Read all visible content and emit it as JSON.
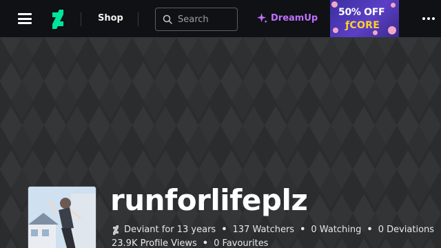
{
  "topbar": {
    "menu_icon": "hamburger-menu-icon",
    "logo_icon": "deviantart-logo-icon",
    "shop_label": "Shop",
    "search": {
      "placeholder": "Search",
      "value": "",
      "icon": "search-icon"
    },
    "dreamup": {
      "label": "DreamUp",
      "icon": "sparkle-icon",
      "color": "#c26fff"
    },
    "promo": {
      "line1": "50% OFF",
      "line2": "ƒCORE"
    },
    "more_icon": "more-dots-icon",
    "background": "#0f1114"
  },
  "profile": {
    "username": "runforlifeplz",
    "stats_line1": [
      {
        "text": "Deviant for 13 years"
      },
      {
        "text": "137 Watchers"
      },
      {
        "text": "0 Watching"
      },
      {
        "text": "0 Deviations"
      }
    ],
    "stats_line2": [
      {
        "text": "23.9K Profile Views"
      },
      {
        "text": "0 Favourites"
      }
    ],
    "separator": "•"
  },
  "colors": {
    "banner_background": "#2b2c2e",
    "banner_pattern": "#36373a",
    "accent": "#00e59b"
  }
}
